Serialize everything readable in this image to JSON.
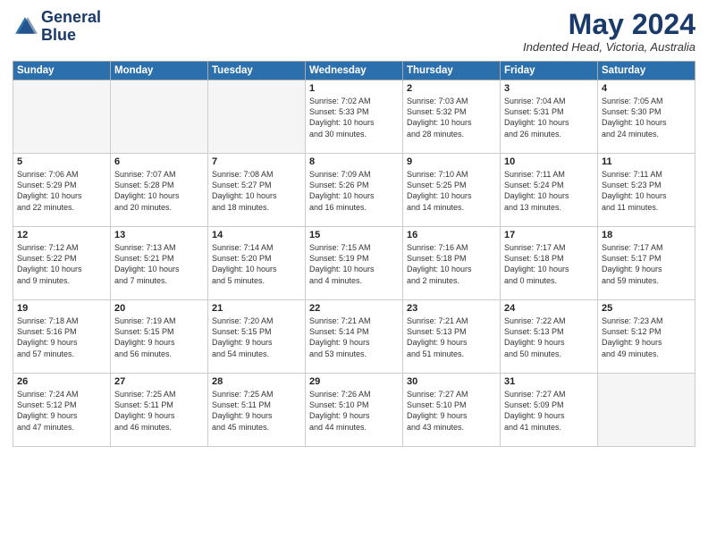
{
  "logo": {
    "line1": "General",
    "line2": "Blue"
  },
  "title": "May 2024",
  "location": "Indented Head, Victoria, Australia",
  "weekdays": [
    "Sunday",
    "Monday",
    "Tuesday",
    "Wednesday",
    "Thursday",
    "Friday",
    "Saturday"
  ],
  "weeks": [
    [
      {
        "day": "",
        "info": ""
      },
      {
        "day": "",
        "info": ""
      },
      {
        "day": "",
        "info": ""
      },
      {
        "day": "1",
        "info": "Sunrise: 7:02 AM\nSunset: 5:33 PM\nDaylight: 10 hours\nand 30 minutes."
      },
      {
        "day": "2",
        "info": "Sunrise: 7:03 AM\nSunset: 5:32 PM\nDaylight: 10 hours\nand 28 minutes."
      },
      {
        "day": "3",
        "info": "Sunrise: 7:04 AM\nSunset: 5:31 PM\nDaylight: 10 hours\nand 26 minutes."
      },
      {
        "day": "4",
        "info": "Sunrise: 7:05 AM\nSunset: 5:30 PM\nDaylight: 10 hours\nand 24 minutes."
      }
    ],
    [
      {
        "day": "5",
        "info": "Sunrise: 7:06 AM\nSunset: 5:29 PM\nDaylight: 10 hours\nand 22 minutes."
      },
      {
        "day": "6",
        "info": "Sunrise: 7:07 AM\nSunset: 5:28 PM\nDaylight: 10 hours\nand 20 minutes."
      },
      {
        "day": "7",
        "info": "Sunrise: 7:08 AM\nSunset: 5:27 PM\nDaylight: 10 hours\nand 18 minutes."
      },
      {
        "day": "8",
        "info": "Sunrise: 7:09 AM\nSunset: 5:26 PM\nDaylight: 10 hours\nand 16 minutes."
      },
      {
        "day": "9",
        "info": "Sunrise: 7:10 AM\nSunset: 5:25 PM\nDaylight: 10 hours\nand 14 minutes."
      },
      {
        "day": "10",
        "info": "Sunrise: 7:11 AM\nSunset: 5:24 PM\nDaylight: 10 hours\nand 13 minutes."
      },
      {
        "day": "11",
        "info": "Sunrise: 7:11 AM\nSunset: 5:23 PM\nDaylight: 10 hours\nand 11 minutes."
      }
    ],
    [
      {
        "day": "12",
        "info": "Sunrise: 7:12 AM\nSunset: 5:22 PM\nDaylight: 10 hours\nand 9 minutes."
      },
      {
        "day": "13",
        "info": "Sunrise: 7:13 AM\nSunset: 5:21 PM\nDaylight: 10 hours\nand 7 minutes."
      },
      {
        "day": "14",
        "info": "Sunrise: 7:14 AM\nSunset: 5:20 PM\nDaylight: 10 hours\nand 5 minutes."
      },
      {
        "day": "15",
        "info": "Sunrise: 7:15 AM\nSunset: 5:19 PM\nDaylight: 10 hours\nand 4 minutes."
      },
      {
        "day": "16",
        "info": "Sunrise: 7:16 AM\nSunset: 5:18 PM\nDaylight: 10 hours\nand 2 minutes."
      },
      {
        "day": "17",
        "info": "Sunrise: 7:17 AM\nSunset: 5:18 PM\nDaylight: 10 hours\nand 0 minutes."
      },
      {
        "day": "18",
        "info": "Sunrise: 7:17 AM\nSunset: 5:17 PM\nDaylight: 9 hours\nand 59 minutes."
      }
    ],
    [
      {
        "day": "19",
        "info": "Sunrise: 7:18 AM\nSunset: 5:16 PM\nDaylight: 9 hours\nand 57 minutes."
      },
      {
        "day": "20",
        "info": "Sunrise: 7:19 AM\nSunset: 5:15 PM\nDaylight: 9 hours\nand 56 minutes."
      },
      {
        "day": "21",
        "info": "Sunrise: 7:20 AM\nSunset: 5:15 PM\nDaylight: 9 hours\nand 54 minutes."
      },
      {
        "day": "22",
        "info": "Sunrise: 7:21 AM\nSunset: 5:14 PM\nDaylight: 9 hours\nand 53 minutes."
      },
      {
        "day": "23",
        "info": "Sunrise: 7:21 AM\nSunset: 5:13 PM\nDaylight: 9 hours\nand 51 minutes."
      },
      {
        "day": "24",
        "info": "Sunrise: 7:22 AM\nSunset: 5:13 PM\nDaylight: 9 hours\nand 50 minutes."
      },
      {
        "day": "25",
        "info": "Sunrise: 7:23 AM\nSunset: 5:12 PM\nDaylight: 9 hours\nand 49 minutes."
      }
    ],
    [
      {
        "day": "26",
        "info": "Sunrise: 7:24 AM\nSunset: 5:12 PM\nDaylight: 9 hours\nand 47 minutes."
      },
      {
        "day": "27",
        "info": "Sunrise: 7:25 AM\nSunset: 5:11 PM\nDaylight: 9 hours\nand 46 minutes."
      },
      {
        "day": "28",
        "info": "Sunrise: 7:25 AM\nSunset: 5:11 PM\nDaylight: 9 hours\nand 45 minutes."
      },
      {
        "day": "29",
        "info": "Sunrise: 7:26 AM\nSunset: 5:10 PM\nDaylight: 9 hours\nand 44 minutes."
      },
      {
        "day": "30",
        "info": "Sunrise: 7:27 AM\nSunset: 5:10 PM\nDaylight: 9 hours\nand 43 minutes."
      },
      {
        "day": "31",
        "info": "Sunrise: 7:27 AM\nSunset: 5:09 PM\nDaylight: 9 hours\nand 41 minutes."
      },
      {
        "day": "",
        "info": ""
      }
    ]
  ]
}
